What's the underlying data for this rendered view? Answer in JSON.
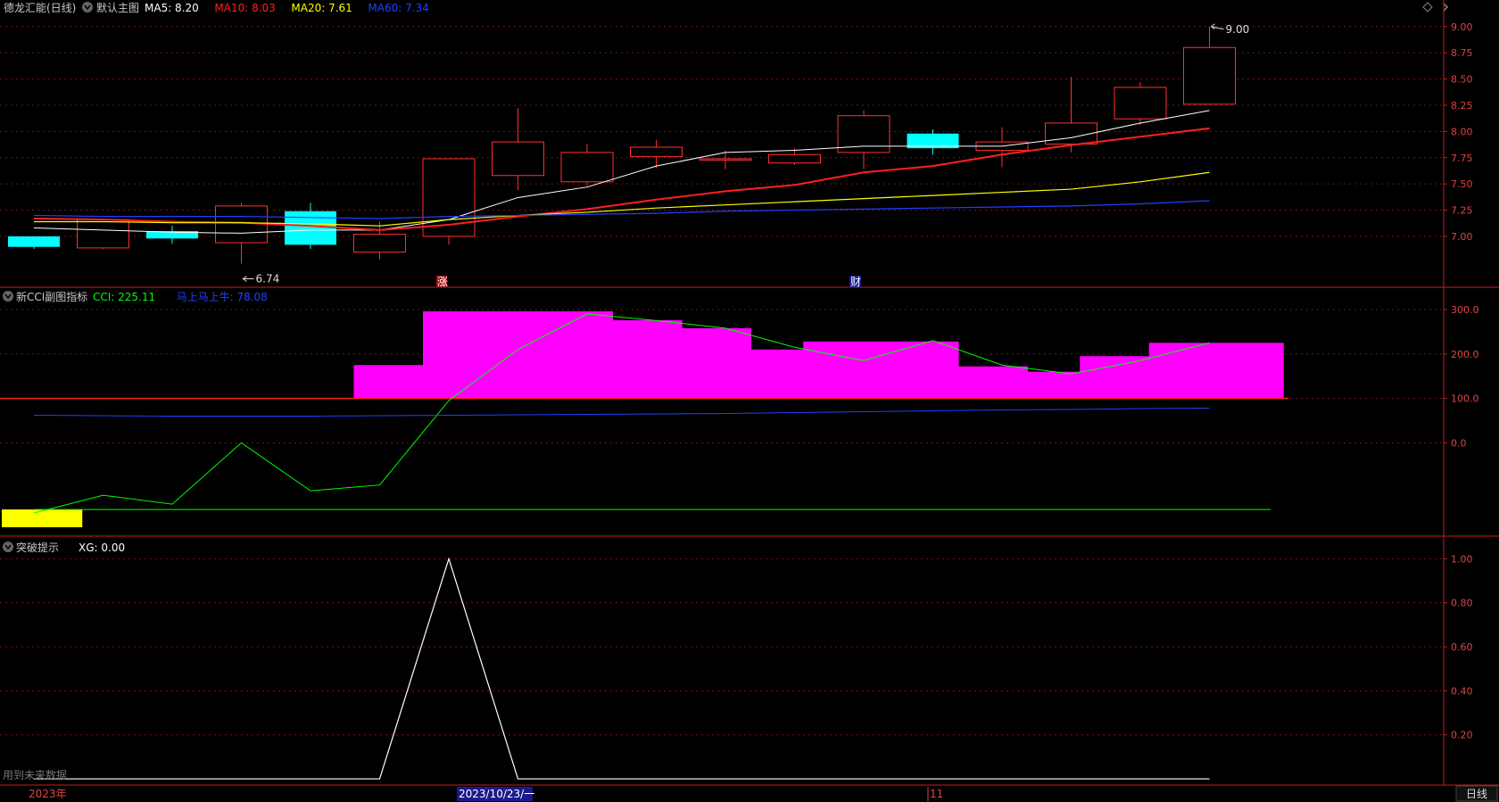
{
  "panels": {
    "main": {
      "title": "德龙汇能(日线)",
      "indicator_name": "默认主图",
      "labels": [
        {
          "text": "MA5: 8.20",
          "color": "#ffffff"
        },
        {
          "text": "MA10: 8.03",
          "color": "#ff2020"
        },
        {
          "text": "MA20: 7.61",
          "color": "#ffff00"
        },
        {
          "text": "MA60: 7.34",
          "color": "#2040ff"
        }
      ],
      "high_label": "9.00",
      "low_label": "6.74",
      "markers": [
        "涨",
        "财"
      ]
    },
    "cci": {
      "title": "新CCI副图指标",
      "labels": [
        {
          "text": "CCI: 225.11",
          "color": "#00ff00"
        },
        {
          "text": "马上马上牛: 78.08",
          "color": "#2040ff"
        }
      ]
    },
    "xg": {
      "title": "突破提示",
      "labels": [
        {
          "text": "XG: 0.00",
          "color": "#ffffff"
        }
      ],
      "note": "用到未来数据"
    }
  },
  "bottom_bar": {
    "year_label": "2023年",
    "cursor_date": "2023/10/23/一",
    "month_label": "11",
    "period_button": "日线"
  },
  "colors": {
    "up": "#ff3030",
    "down": "#00ffff",
    "ma5": "#ffffff",
    "ma10": "#ff2020",
    "ma20": "#ffff00",
    "ma60": "#2040ff",
    "cci_bar": "#ff00ff",
    "cci_line": "#00ff00",
    "yellow_block": "#ffff00",
    "axis": "#c81e1e",
    "grid": "#7a1414"
  },
  "chart_data": [
    {
      "type": "candlestick",
      "title": "德龙汇能(日线)",
      "ylim": [
        6.6,
        9.1
      ],
      "yticks": [
        7.0,
        7.25,
        7.5,
        7.75,
        8.0,
        8.25,
        8.5,
        8.75,
        9.0
      ],
      "candles": [
        {
          "o": 7.0,
          "h": 7.0,
          "l": 6.88,
          "c": 6.9
        },
        {
          "o": 6.89,
          "h": 7.16,
          "l": 6.88,
          "c": 7.16
        },
        {
          "o": 7.05,
          "h": 7.1,
          "l": 6.93,
          "c": 6.98
        },
        {
          "o": 6.94,
          "h": 7.32,
          "l": 6.74,
          "c": 7.29
        },
        {
          "o": 7.24,
          "h": 7.32,
          "l": 6.88,
          "c": 6.92
        },
        {
          "o": 6.85,
          "h": 7.14,
          "l": 6.78,
          "c": 7.02
        },
        {
          "o": 7.0,
          "h": 7.74,
          "l": 6.92,
          "c": 7.74
        },
        {
          "o": 7.58,
          "h": 8.22,
          "l": 7.44,
          "c": 7.9
        },
        {
          "o": 7.52,
          "h": 7.88,
          "l": 7.48,
          "c": 7.8
        },
        {
          "o": 7.76,
          "h": 7.92,
          "l": 7.65,
          "c": 7.85
        },
        {
          "o": 7.74,
          "h": 7.82,
          "l": 7.64,
          "c": 7.74
        },
        {
          "o": 7.7,
          "h": 7.84,
          "l": 7.68,
          "c": 7.78
        },
        {
          "o": 7.8,
          "h": 8.2,
          "l": 7.64,
          "c": 8.15
        },
        {
          "o": 7.98,
          "h": 8.02,
          "l": 7.78,
          "c": 7.84
        },
        {
          "o": 7.82,
          "h": 8.04,
          "l": 7.66,
          "c": 7.9
        },
        {
          "o": 7.88,
          "h": 8.52,
          "l": 7.8,
          "c": 8.08
        },
        {
          "o": 8.12,
          "h": 8.47,
          "l": 8.06,
          "c": 8.42
        },
        {
          "o": 8.26,
          "h": 9.0,
          "l": 8.26,
          "c": 8.8
        }
      ],
      "series": [
        {
          "name": "MA5",
          "values": [
            7.08,
            7.06,
            7.04,
            7.03,
            7.06,
            7.06,
            7.16,
            7.37,
            7.47,
            7.67,
            7.8,
            7.82,
            7.86,
            7.86,
            7.86,
            7.94,
            8.08,
            8.2
          ]
        },
        {
          "name": "MA10",
          "values": [
            7.17,
            7.16,
            7.14,
            7.13,
            7.1,
            7.06,
            7.11,
            7.19,
            7.26,
            7.35,
            7.43,
            7.49,
            7.61,
            7.67,
            7.78,
            7.87,
            7.95,
            8.03
          ]
        },
        {
          "name": "MA20",
          "values": [
            7.14,
            7.14,
            7.13,
            7.13,
            7.12,
            7.1,
            7.16,
            7.2,
            7.23,
            7.27,
            7.3,
            7.33,
            7.36,
            7.39,
            7.42,
            7.45,
            7.52,
            7.61
          ]
        },
        {
          "name": "MA60",
          "values": [
            7.2,
            7.19,
            7.19,
            7.19,
            7.18,
            7.17,
            7.19,
            7.2,
            7.21,
            7.22,
            7.24,
            7.25,
            7.26,
            7.27,
            7.28,
            7.29,
            7.31,
            7.34
          ]
        }
      ]
    },
    {
      "type": "bar",
      "title": "新CCI副图指标",
      "ylim": [
        -200,
        330
      ],
      "yticks": [
        0.0,
        100.0,
        200.0,
        300.0
      ],
      "bars": [
        {
          "from": 5,
          "to": 6,
          "value": 175
        },
        {
          "from": 6,
          "to": 8,
          "value": 296
        },
        {
          "from": 8,
          "to": 9,
          "value": 276
        },
        {
          "from": 9,
          "to": 10,
          "value": 258
        },
        {
          "from": 10,
          "to": 11,
          "value": 210
        },
        {
          "from": 11,
          "to": 11.5,
          "value": 185
        },
        {
          "from": 11.5,
          "to": 13,
          "value": 228
        },
        {
          "from": 13,
          "to": 14,
          "value": 172
        },
        {
          "from": 14,
          "to": 14.5,
          "value": 150
        },
        {
          "from": 14.5,
          "to": 15.5,
          "value": 160
        },
        {
          "from": 15.5,
          "to": 16.5,
          "value": 195
        },
        {
          "from": 16.5,
          "to": 17.7,
          "value": 225
        }
      ],
      "series": [
        {
          "name": "CCI",
          "values": [
            -158,
            -118,
            -138,
            0,
            -108,
            -95,
            95,
            210,
            290,
            275,
            258,
            215,
            185,
            230,
            175,
            155,
            185,
            225.11
          ]
        },
        {
          "name": "马上马上牛",
          "values": [
            62,
            61,
            60,
            60,
            60,
            61,
            62,
            63,
            64,
            65,
            66,
            68,
            70,
            72,
            74,
            75,
            77,
            78.08
          ]
        }
      ],
      "baseline_red": 100,
      "baseline_green": -150,
      "yellow_block": {
        "from": -0.4,
        "to": 0.7,
        "top": -150,
        "bottom": -190
      }
    },
    {
      "type": "line",
      "title": "突破提示",
      "ylim": [
        -0.02,
        1.05
      ],
      "yticks": [
        0.2,
        0.4,
        0.6,
        0.8,
        1.0
      ],
      "series": [
        {
          "name": "XG",
          "values": [
            0,
            0,
            0,
            0,
            0,
            0,
            1,
            0,
            0,
            0,
            0,
            0,
            0,
            0,
            0,
            0,
            0,
            0
          ]
        }
      ]
    }
  ]
}
